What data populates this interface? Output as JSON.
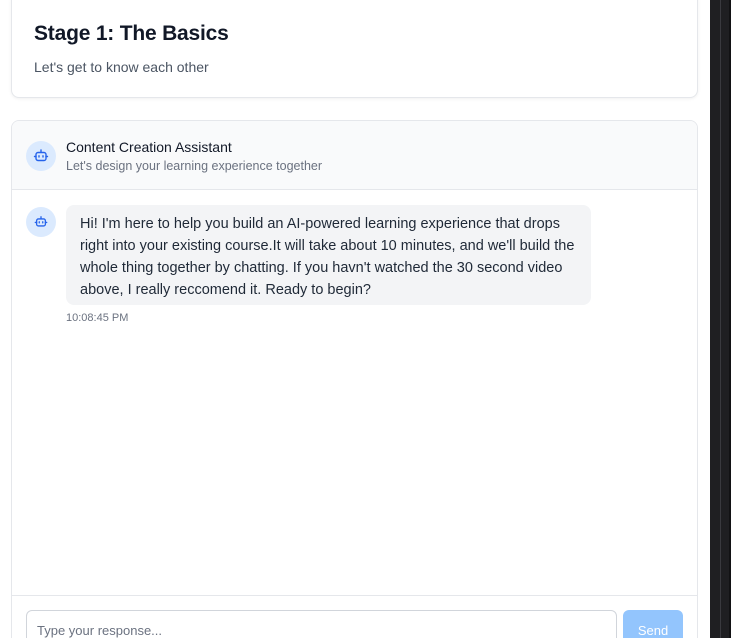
{
  "stage": {
    "title": "Stage 1: The Basics",
    "subtitle": "Let's get to know each other"
  },
  "chat": {
    "header": {
      "title": "Content Creation Assistant",
      "subtitle": "Let's design your learning experience together",
      "icon": "bot-icon"
    },
    "messages": [
      {
        "sender": "assistant",
        "icon": "bot-icon",
        "text": "Hi! I'm here to help you build an AI-powered learning experience that drops right into your existing course.It will take about 10 minutes, and we'll build the whole thing together by chatting. If you havn't watched the 30 second video above, I really reccomend it. Ready to begin?",
        "time": "10:08:45 PM"
      }
    ],
    "composer": {
      "placeholder": "Type your response...",
      "value": "",
      "send_label": "Send"
    }
  },
  "colors": {
    "accent_light": "#dbeafe",
    "accent": "#2563eb",
    "send_disabled": "#93c5fd",
    "bubble": "#f3f4f6"
  }
}
